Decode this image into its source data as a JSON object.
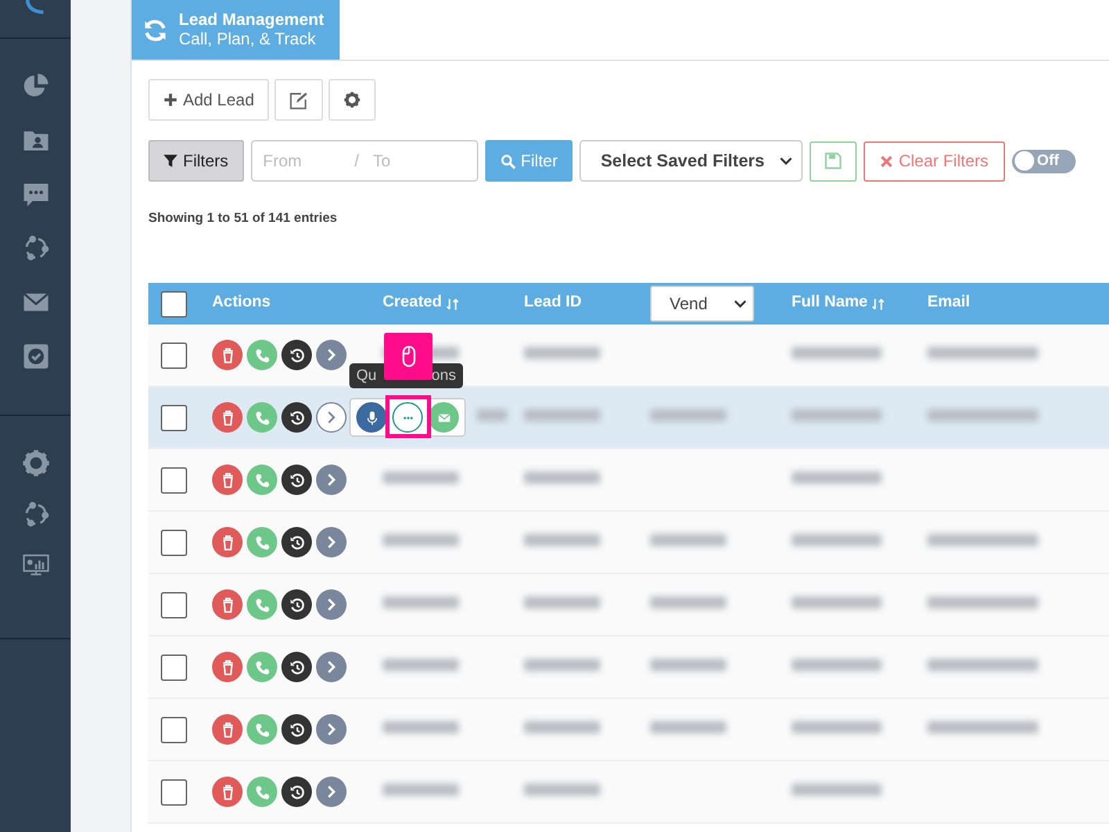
{
  "header": {
    "title": "Lead Management",
    "subtitle": "Call, Plan, & Track"
  },
  "toolbar": {
    "add_button": "Add Lead"
  },
  "filters": {
    "filters_button": "Filters",
    "from_placeholder": "From",
    "separator": "/",
    "to_placeholder": "To",
    "filter_button": "Filter",
    "saved_filters": "Select Saved Filters",
    "clear_button": "Clear Filters",
    "toggle": {
      "label": "Off",
      "on": false
    }
  },
  "summary": "Showing 1 to 51 of 141 entries",
  "table": {
    "columns": [
      {
        "kind": "checkbox",
        "checked": false
      },
      {
        "kind": "text",
        "label": "Actions",
        "sortable": false
      },
      {
        "kind": "text",
        "label": "Created",
        "sortable": true
      },
      {
        "kind": "text",
        "label": "Lead ID",
        "sortable": false
      },
      {
        "kind": "select",
        "label": "Vend"
      },
      {
        "kind": "text",
        "label": "Full Name",
        "sortable": true
      },
      {
        "kind": "text",
        "label": "Email",
        "sortable": false
      }
    ],
    "rows": [
      {
        "checked": false,
        "selected": false,
        "expanded": false,
        "redacted": [
          true,
          true,
          false,
          true,
          true
        ]
      },
      {
        "checked": false,
        "selected": true,
        "expanded": true,
        "redacted": [
          true,
          true,
          true,
          true,
          true
        ]
      },
      {
        "checked": false,
        "selected": false,
        "expanded": false,
        "redacted": [
          true,
          true,
          false,
          true,
          false
        ]
      },
      {
        "checked": false,
        "selected": false,
        "expanded": false,
        "redacted": [
          true,
          true,
          true,
          true,
          true
        ]
      },
      {
        "checked": false,
        "selected": false,
        "expanded": false,
        "redacted": [
          true,
          true,
          true,
          true,
          true
        ]
      },
      {
        "checked": false,
        "selected": false,
        "expanded": false,
        "redacted": [
          true,
          true,
          true,
          true,
          true
        ]
      },
      {
        "checked": false,
        "selected": false,
        "expanded": false,
        "redacted": [
          true,
          true,
          true,
          true,
          true
        ]
      },
      {
        "checked": false,
        "selected": false,
        "expanded": false,
        "redacted": [
          true,
          true,
          false,
          true,
          false
        ]
      }
    ]
  },
  "quick_actions": {
    "tooltip_start": "Qu",
    "tooltip_end": "ons"
  }
}
